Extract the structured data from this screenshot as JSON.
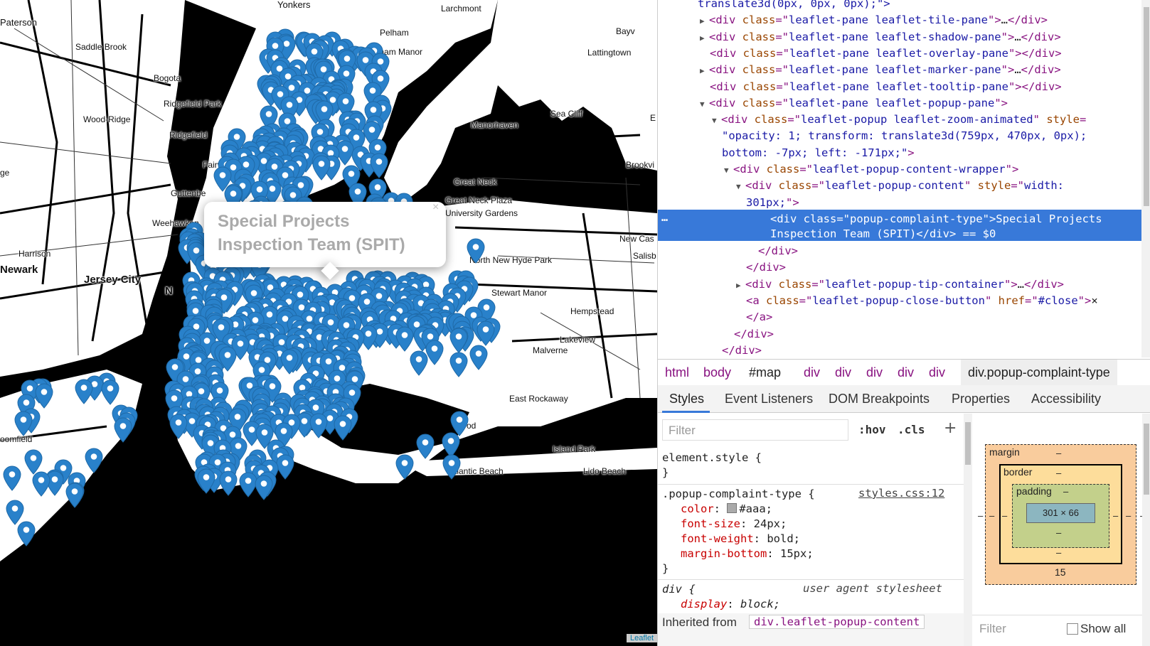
{
  "map": {
    "places": [
      {
        "name": "Yonkers",
        "cls": "med"
      },
      {
        "name": "Larchmont",
        "cls": ""
      },
      {
        "name": "Paterson",
        "cls": "med"
      },
      {
        "name": "Saddle Brook",
        "cls": ""
      },
      {
        "name": "Pelham",
        "cls": ""
      },
      {
        "name": "Pelham Manor",
        "cls": ""
      },
      {
        "name": "Bayv",
        "cls": ""
      },
      {
        "name": "Lattingtown",
        "cls": ""
      },
      {
        "name": "Bogota",
        "cls": ""
      },
      {
        "name": "Ridgefield Park",
        "cls": ""
      },
      {
        "name": "Wood-Ridge",
        "cls": ""
      },
      {
        "name": "Ridgefield",
        "cls": ""
      },
      {
        "name": "Manorhaven",
        "cls": ""
      },
      {
        "name": "Sea Cliff",
        "cls": ""
      },
      {
        "name": "E",
        "cls": ""
      },
      {
        "name": "Fairview",
        "cls": ""
      },
      {
        "name": "ge",
        "cls": ""
      },
      {
        "name": "Guttenbe",
        "cls": ""
      },
      {
        "name": "Great Neck",
        "cls": ""
      },
      {
        "name": "Great Neck Plaza",
        "cls": ""
      },
      {
        "name": "University Gardens",
        "cls": ""
      },
      {
        "name": "Brookvi",
        "cls": ""
      },
      {
        "name": "Weehawken",
        "cls": ""
      },
      {
        "name": "New Cas",
        "cls": ""
      },
      {
        "name": "Salisb",
        "cls": ""
      },
      {
        "name": "Harrison",
        "cls": ""
      },
      {
        "name": "Newark",
        "cls": "big"
      },
      {
        "name": "Jersey City",
        "cls": "big"
      },
      {
        "name": "North New Hyde Park",
        "cls": ""
      },
      {
        "name": "N",
        "cls": "big"
      },
      {
        "name": "Stewart Manor",
        "cls": ""
      },
      {
        "name": "Hempstead",
        "cls": ""
      },
      {
        "name": "Lakeview",
        "cls": ""
      },
      {
        "name": "Malverne",
        "cls": ""
      },
      {
        "name": "East Rockaway",
        "cls": ""
      },
      {
        "name": "oomfield",
        "cls": ""
      },
      {
        "name": "od",
        "cls": ""
      },
      {
        "name": "Island Park",
        "cls": ""
      },
      {
        "name": "Atlantic Beach",
        "cls": ""
      },
      {
        "name": "Lido Beach",
        "cls": ""
      }
    ],
    "popup": {
      "text": "Special Projects Inspection Team (SPIT)",
      "close": "×"
    },
    "attribution": "Leaflet",
    "marker_color": "#2981ca"
  },
  "devtools": {
    "dom_lines": [
      {
        "indent": 0,
        "tri": "",
        "parts": [
          [
            "val",
            "translate3d(0px, 0px, 0px);\">"
          ]
        ]
      },
      {
        "indent": 1,
        "tri": "▶",
        "parts": [
          [
            "tag",
            "<div "
          ],
          [
            "attr",
            "class"
          ],
          [
            "tag",
            "=\""
          ],
          [
            "val",
            "leaflet-pane leaflet-tile-pane"
          ],
          [
            "tag",
            "\">"
          ],
          [
            "txt",
            "…"
          ],
          [
            "tag",
            "</div>"
          ]
        ]
      },
      {
        "indent": 1,
        "tri": "▶",
        "parts": [
          [
            "tag",
            "<div "
          ],
          [
            "attr",
            "class"
          ],
          [
            "tag",
            "=\""
          ],
          [
            "val",
            "leaflet-pane leaflet-shadow-pane"
          ],
          [
            "tag",
            "\">"
          ],
          [
            "txt",
            "…"
          ],
          [
            "tag",
            "</div>"
          ]
        ]
      },
      {
        "indent": 1,
        "tri": "",
        "parts": [
          [
            "tag",
            "<div "
          ],
          [
            "attr",
            "class"
          ],
          [
            "tag",
            "=\""
          ],
          [
            "val",
            "leaflet-pane leaflet-overlay-pane"
          ],
          [
            "tag",
            "\"></div>"
          ]
        ]
      },
      {
        "indent": 1,
        "tri": "▶",
        "parts": [
          [
            "tag",
            "<div "
          ],
          [
            "attr",
            "class"
          ],
          [
            "tag",
            "=\""
          ],
          [
            "val",
            "leaflet-pane leaflet-marker-pane"
          ],
          [
            "tag",
            "\">"
          ],
          [
            "txt",
            "…"
          ],
          [
            "tag",
            "</div>"
          ]
        ]
      },
      {
        "indent": 1,
        "tri": "",
        "parts": [
          [
            "tag",
            "<div "
          ],
          [
            "attr",
            "class"
          ],
          [
            "tag",
            "=\""
          ],
          [
            "val",
            "leaflet-pane leaflet-tooltip-pane"
          ],
          [
            "tag",
            "\"></div>"
          ]
        ]
      },
      {
        "indent": 1,
        "tri": "▼",
        "parts": [
          [
            "tag",
            "<div "
          ],
          [
            "attr",
            "class"
          ],
          [
            "tag",
            "=\""
          ],
          [
            "val",
            "leaflet-pane leaflet-popup-pane"
          ],
          [
            "tag",
            "\">"
          ]
        ]
      },
      {
        "indent": 2,
        "tri": "▼",
        "parts": [
          [
            "tag",
            "<div "
          ],
          [
            "attr",
            "class"
          ],
          [
            "tag",
            "=\""
          ],
          [
            "val",
            "leaflet-popup  leaflet-zoom-animated"
          ],
          [
            "tag",
            "\" "
          ],
          [
            "attr",
            "style"
          ],
          [
            "tag",
            "="
          ]
        ]
      },
      {
        "indent": 2,
        "tri": "",
        "parts": [
          [
            "val",
            "\"opacity: 1; transform: translate3d(759px, 470px, 0px);"
          ]
        ]
      },
      {
        "indent": 2,
        "tri": "",
        "parts": [
          [
            "val",
            "bottom: -7px; left: -171px;\""
          ],
          [
            "tag",
            ">"
          ]
        ]
      },
      {
        "indent": 3,
        "tri": "▼",
        "parts": [
          [
            "tag",
            "<div "
          ],
          [
            "attr",
            "class"
          ],
          [
            "tag",
            "=\""
          ],
          [
            "val",
            "leaflet-popup-content-wrapper"
          ],
          [
            "tag",
            "\">"
          ]
        ]
      },
      {
        "indent": 4,
        "tri": "▼",
        "parts": [
          [
            "tag",
            "<div "
          ],
          [
            "attr",
            "class"
          ],
          [
            "tag",
            "=\""
          ],
          [
            "val",
            "leaflet-popup-content"
          ],
          [
            "tag",
            "\" "
          ],
          [
            "attr",
            "style"
          ],
          [
            "tag",
            "=\""
          ],
          [
            "val",
            "width:"
          ]
        ]
      },
      {
        "indent": 4,
        "tri": "",
        "parts": [
          [
            "val",
            "301px;"
          ],
          [
            "tag",
            "\">"
          ]
        ]
      }
    ],
    "selected_lines": [
      "<div class=\"popup-complaint-type\">Special Projects",
      "Inspection Team (SPIT)</div> == $0"
    ],
    "dom_lines_after": [
      {
        "indent": 5,
        "tri": "",
        "parts": [
          [
            "tag",
            "</div>"
          ]
        ]
      },
      {
        "indent": 4,
        "tri": "",
        "parts": [
          [
            "tag",
            "</div>"
          ]
        ]
      },
      {
        "indent": 4,
        "tri": "▶",
        "parts": [
          [
            "tag",
            "<div "
          ],
          [
            "attr",
            "class"
          ],
          [
            "tag",
            "=\""
          ],
          [
            "val",
            "leaflet-popup-tip-container"
          ],
          [
            "tag",
            "\">"
          ],
          [
            "txt",
            "…"
          ],
          [
            "tag",
            "</div>"
          ]
        ]
      },
      {
        "indent": 4,
        "tri": "",
        "parts": [
          [
            "tag",
            "<a "
          ],
          [
            "attr",
            "class"
          ],
          [
            "tag",
            "=\""
          ],
          [
            "val",
            "leaflet-popup-close-button"
          ],
          [
            "tag",
            "\" "
          ],
          [
            "attr",
            "href"
          ],
          [
            "tag",
            "=\""
          ],
          [
            "val",
            "#close"
          ],
          [
            "tag",
            "\">"
          ],
          [
            "txt",
            "×"
          ]
        ]
      },
      {
        "indent": 4,
        "tri": "",
        "parts": [
          [
            "tag",
            "</a>"
          ]
        ]
      },
      {
        "indent": 3,
        "tri": "",
        "parts": [
          [
            "tag",
            "</div>"
          ]
        ]
      },
      {
        "indent": 2,
        "tri": "",
        "parts": [
          [
            "tag",
            "</div>"
          ]
        ]
      }
    ],
    "breadcrumbs": [
      "html",
      "body",
      "#map",
      "div",
      "div",
      "div",
      "div",
      "div",
      "div.popup-complaint-type"
    ],
    "tabs": [
      "Styles",
      "Event Listeners",
      "DOM Breakpoints",
      "Properties",
      "Accessibility"
    ],
    "styles": {
      "filter_placeholder": "Filter",
      "hov": ":hov",
      "cls": ".cls",
      "plus": "+",
      "element_style": "element.style {",
      "close_brace": "}",
      "rule_selector": ".popup-complaint-type {",
      "rule_source": "styles.css:12",
      "props": [
        {
          "name": "color",
          "value": "#aaa;",
          "swatch": true
        },
        {
          "name": "font-size",
          "value": "24px;"
        },
        {
          "name": "font-weight",
          "value": "bold;"
        },
        {
          "name": "margin-bottom",
          "value": "15px;"
        }
      ],
      "ua_selector": "div {",
      "ua_label": "user agent stylesheet",
      "ua_prop": {
        "name": "display",
        "value": "block;"
      },
      "inherited_label": "Inherited from",
      "inherited_from": "div.leaflet-popup-content"
    },
    "box_model": {
      "margin_label": "margin",
      "border_label": "border",
      "padding_label": "padding",
      "content": "301 × 66",
      "dash": "–",
      "margin_bottom": "15",
      "filter_placeholder": "Filter",
      "show_all": "Show all"
    }
  }
}
